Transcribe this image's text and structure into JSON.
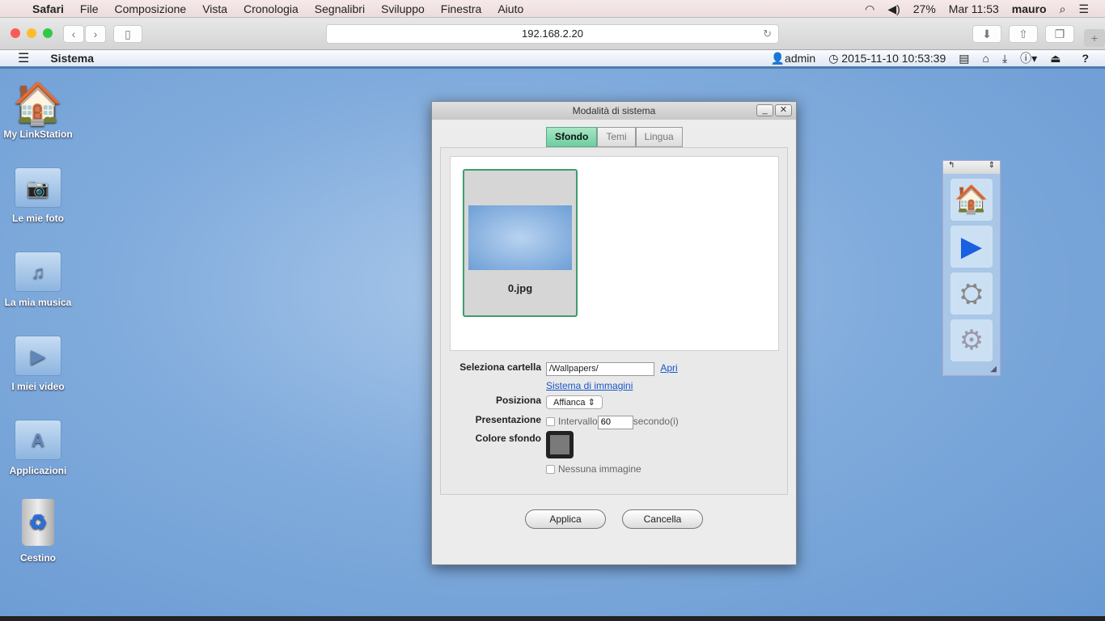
{
  "menubar": {
    "app": "Safari",
    "items": [
      "File",
      "Composizione",
      "Vista",
      "Cronologia",
      "Segnalibri",
      "Sviluppo",
      "Finestra",
      "Aiuto"
    ],
    "battery": "27%",
    "clock": "Mar 11:53",
    "user": "mauro"
  },
  "browser": {
    "url": "192.168.2.20"
  },
  "appbar": {
    "title": "Sistema",
    "user": "admin",
    "datetime": "2015-11-10 10:53:39"
  },
  "desktop": {
    "icons": [
      "My LinkStation",
      "Le mie foto",
      "La mia musica",
      "I miei video",
      "Applicazioni",
      "Cestino"
    ]
  },
  "dialog": {
    "title": "Modalità di sistema",
    "tabs": [
      "Sfondo",
      "Temi",
      "Lingua"
    ],
    "active_tab": "Sfondo",
    "thumbnail": {
      "name": "0.jpg"
    },
    "folder_label": "Seleziona cartella",
    "folder_value": "/Wallpapers/",
    "open_link": "Apri",
    "system_images_link": "Sistema di immagini",
    "position_label": "Posiziona",
    "position_value": "Affianca",
    "slideshow_label": "Presentazione",
    "interval_label": "Intervallo",
    "interval_value": "60",
    "interval_unit": "secondo(i)",
    "bgcolor_label": "Colore sfondo",
    "bgcolor": "#7a7a7a",
    "no_image_label": "Nessuna immagine",
    "apply": "Applica",
    "cancel": "Cancella"
  }
}
